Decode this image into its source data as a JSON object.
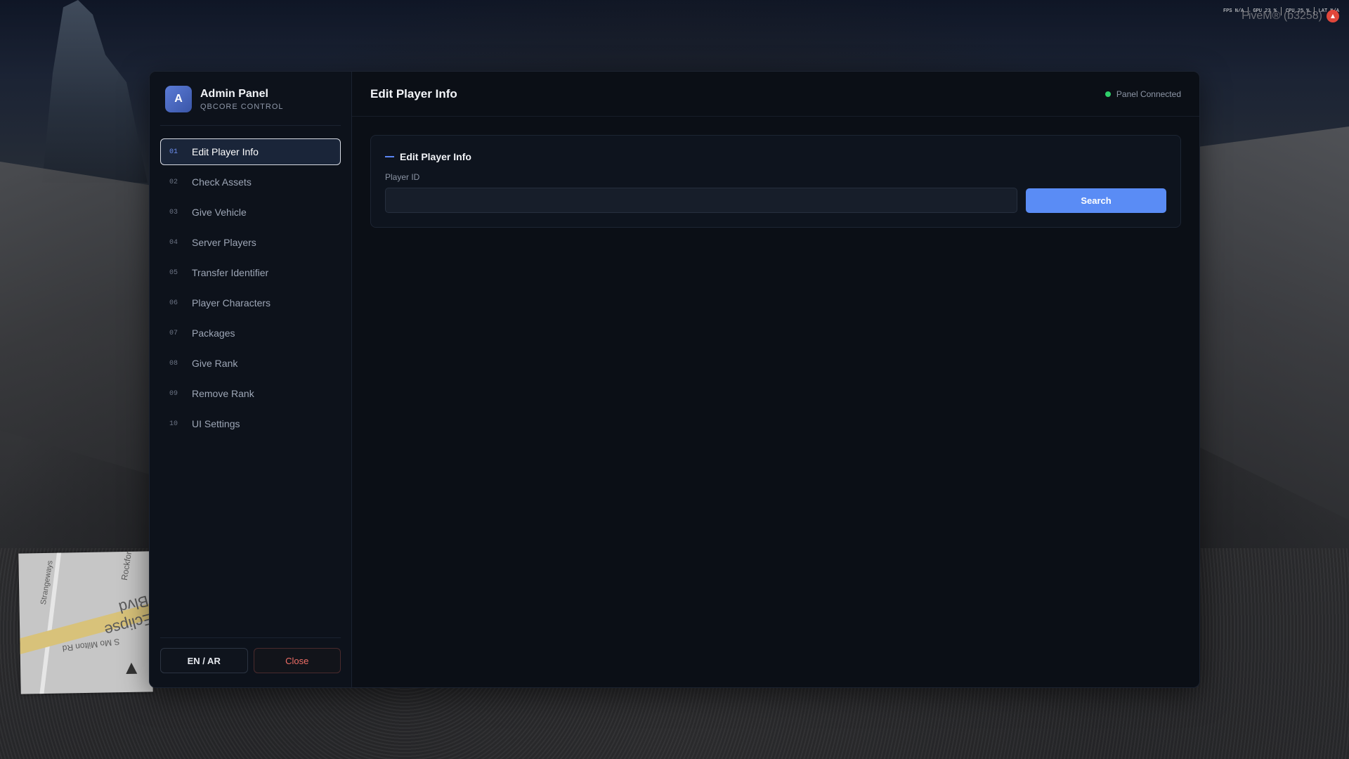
{
  "hud": {
    "fps": "FPS N/A",
    "gpu": "GPU 23 %",
    "cpu": "CPU 25 %",
    "lat": "LAT N/A",
    "fivem_label": "FiveM® (b3258)"
  },
  "minimap": {
    "street_main": "Eclipse Blvd",
    "street_side1": "Strangeways",
    "street_side2": "Rockford",
    "street_bottom": "S Mo Milton Rd"
  },
  "sidebar": {
    "logo_letter": "A",
    "title": "Admin Panel",
    "subtitle": "QBCORE CONTROL",
    "items": [
      {
        "num": "01",
        "label": "Edit Player Info"
      },
      {
        "num": "02",
        "label": "Check Assets"
      },
      {
        "num": "03",
        "label": "Give Vehicle"
      },
      {
        "num": "04",
        "label": "Server Players"
      },
      {
        "num": "05",
        "label": "Transfer Identifier"
      },
      {
        "num": "06",
        "label": "Player Characters"
      },
      {
        "num": "07",
        "label": "Packages"
      },
      {
        "num": "08",
        "label": "Give Rank"
      },
      {
        "num": "09",
        "label": "Remove Rank"
      },
      {
        "num": "10",
        "label": "UI Settings"
      }
    ],
    "active_index": 0,
    "lang_button": "EN / AR",
    "close_button": "Close"
  },
  "header": {
    "title": "Edit Player Info",
    "status": "Panel Connected",
    "status_color": "#2fcf6a"
  },
  "card": {
    "title": "Edit Player Info",
    "field_label": "Player ID",
    "input_value": "",
    "input_placeholder": "",
    "search_button": "Search"
  },
  "colors": {
    "accent": "#5a8cf5",
    "close_text": "#ee6e66"
  }
}
